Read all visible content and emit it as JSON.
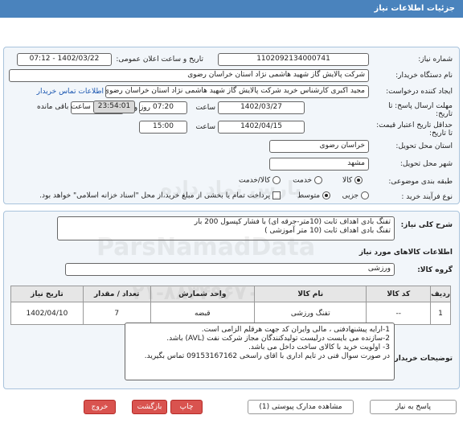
{
  "header": {
    "title": "جزئیات اطلاعات نیاز"
  },
  "info": {
    "need_number_label": "شماره نیاز:",
    "need_number": "1102092134000741",
    "announce_label": "تاریخ و ساعت اعلان عمومی:",
    "announce_value": "1402/03/22 - 07:12",
    "buyer_org_label": "نام دستگاه خریدار:",
    "buyer_org": "شرکت پالایش گاز شهید هاشمی نژاد   استان خراسان رضوی",
    "creator_label": "ایجاد کننده درخواست:",
    "creator": "مجید اکبری کارشناس خرید شرکت پالایش گاز شهید هاشمی نژاد   استان خراسان رضوی",
    "contact_link": "اطلاعات تماس خریدار",
    "deadline_label": "مهلت ارسال پاسخ: تا تاریخ:",
    "deadline_date": "1402/03/27",
    "time_label": "ساعت",
    "deadline_time": "07:20",
    "days": "4",
    "days_label": "روز و",
    "remaining": "23:54:01",
    "remaining_label": "ساعت باقی مانده",
    "validity_label": "حداقل تاریخ اعتبار قیمت: تا تاریخ:",
    "validity_date": "1402/04/15",
    "validity_time": "15:00",
    "province_label": "استان محل تحویل:",
    "province": "خراسان رضوی",
    "city_label": "شهر محل تحویل:",
    "city": "مشهد",
    "category_label": "طبقه بندی موضوعی:",
    "category_options": [
      "کالا",
      "خدمت",
      "کالا/خدمت"
    ],
    "process_label": "نوع فرآیند خرید :",
    "process_options": [
      "جزیی",
      "متوسط"
    ],
    "payment_note": "پرداخت تمام یا بخشی از مبلغ خرید،از محل \"اسناد خزانه اسلامی\" خواهد بود."
  },
  "description": {
    "label": "شرح کلی نیاز:",
    "line1": "تفنگ بادی اهداف ثابت (10متر-جرقه ای) با فشار کپسول 200 بار",
    "line2": "تفنگ بادی اهداف ثابت (10 متر آموزشی )"
  },
  "goods": {
    "title": "اطلاعات کالاهای مورد نیاز",
    "group_label": "گروه کالا:",
    "group_value": "ورزشی",
    "columns": [
      "ردیف",
      "کد کالا",
      "نام کالا",
      "واحد شمارش",
      "تعداد / مقدار",
      "تاریخ نیاز"
    ],
    "rows": [
      {
        "row": "1",
        "code": "--",
        "name": "تفنگ ورزشی",
        "unit": "قبضه",
        "qty": "7",
        "date": "1402/04/10"
      }
    ]
  },
  "buyer_notes": {
    "label": "توضیحات خریدار:",
    "lines": [
      "1-ارایه پیشنهادفنی ، مالی وایران کد جهت هرقلم الزامی است.",
      "2-سازنده می بایست درلیست تولیدکنندگان مجاز شرکت نفت (AVL)  باشد.",
      "3- اولویت خرید  با کالای ساخت  داخل می باشد.",
      "در صورت سوال فنی در تایم اداری با اقای راسخی 09153167162 تماس بگیرید."
    ]
  },
  "buttons": {
    "reply": "پاسخ به نیاز",
    "attachments": "مشاهده مدارک پیوستی (1)",
    "print": "چاپ",
    "back": "بازگشت",
    "exit": "خروج"
  },
  "watermark": {
    "line1": "ParsNamadData",
    "line2": "پارس نماد داده",
    "line3": "۰۲۱-۸۸۳۴۹۶۷۰"
  }
}
